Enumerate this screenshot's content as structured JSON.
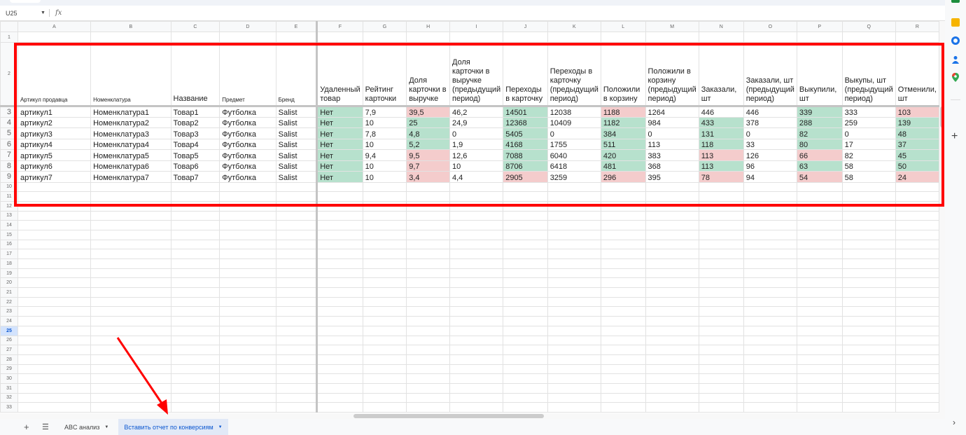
{
  "formula_bar": {
    "cell_ref": "U25",
    "fx": "fx"
  },
  "columns": [
    "A",
    "B",
    "C",
    "D",
    "E",
    "F",
    "G",
    "H",
    "I",
    "J",
    "K",
    "L",
    "M",
    "N",
    "O",
    "P",
    "Q",
    "R"
  ],
  "selected_row": 25,
  "total_rows": 33,
  "headers": [
    "Артикул продавца",
    "Номенклатура",
    "Название",
    "Предмет",
    "Бренд",
    "Удаленный товар",
    "Рейтинг карточки",
    "Доля карточки в выручке",
    "Доля карточки в выручке (предыдущий период)",
    "Переходы в карточку",
    "Переходы в карточку (предыдущий период)",
    "Положили в корзину",
    "Положили в корзину (предыдущий период)",
    "Заказали, шт",
    "Заказали, шт (предыдущий период)",
    "Выкупили, шт",
    "Выкупы, шт (предыдущий период)",
    "Отменили, шт"
  ],
  "rows": [
    [
      "артикул1",
      "Номенклатура1",
      "Товар1",
      "Футболка",
      "Salist",
      "Нет",
      "7,9",
      "39,5",
      "46,2",
      "14501",
      "12038",
      "1188",
      "1264",
      "446",
      "446",
      "339",
      "333",
      "103"
    ],
    [
      "артикул2",
      "Номенклатура2",
      "Товар2",
      "Футболка",
      "Salist",
      "Нет",
      "10",
      "25",
      "24,9",
      "12368",
      "10409",
      "1182",
      "984",
      "433",
      "378",
      "288",
      "259",
      "139"
    ],
    [
      "артикул3",
      "Номенклатура3",
      "Товар3",
      "Футболка",
      "Salist",
      "Нет",
      "7,8",
      "4,8",
      "0",
      "5405",
      "0",
      "384",
      "0",
      "131",
      "0",
      "82",
      "0",
      "48"
    ],
    [
      "артикул4",
      "Номенклатура4",
      "Товар4",
      "Футболка",
      "Salist",
      "Нет",
      "10",
      "5,2",
      "1,9",
      "4168",
      "1755",
      "511",
      "113",
      "118",
      "33",
      "80",
      "17",
      "37"
    ],
    [
      "артикул5",
      "Номенклатура5",
      "Товар5",
      "Футболка",
      "Salist",
      "Нет",
      "9,4",
      "9,5",
      "12,6",
      "7088",
      "6040",
      "420",
      "383",
      "113",
      "126",
      "66",
      "82",
      "45"
    ],
    [
      "артикул6",
      "Номенклатура6",
      "Товар6",
      "Футболка",
      "Salist",
      "Нет",
      "10",
      "9,7",
      "10",
      "8706",
      "6418",
      "481",
      "368",
      "113",
      "96",
      "63",
      "58",
      "50"
    ],
    [
      "артикул7",
      "Номенклатура7",
      "Товар7",
      "Футболка",
      "Salist",
      "Нет",
      "10",
      "3,4",
      "4,4",
      "2905",
      "3259",
      "296",
      "395",
      "78",
      "94",
      "54",
      "58",
      "24"
    ]
  ],
  "cell_colors": [
    [
      "",
      "",
      "",
      "",
      "",
      "g",
      "",
      "r",
      "",
      "g",
      "",
      "r",
      "",
      "",
      "",
      "g",
      "",
      "r"
    ],
    [
      "",
      "",
      "",
      "",
      "",
      "g",
      "",
      "g",
      "",
      "g",
      "",
      "g",
      "",
      "g",
      "",
      "g",
      "",
      "g"
    ],
    [
      "",
      "",
      "",
      "",
      "",
      "g",
      "",
      "g",
      "",
      "g",
      "",
      "g",
      "",
      "g",
      "",
      "g",
      "",
      "g"
    ],
    [
      "",
      "",
      "",
      "",
      "",
      "g",
      "",
      "g",
      "",
      "g",
      "",
      "g",
      "",
      "g",
      "",
      "g",
      "",
      "g"
    ],
    [
      "",
      "",
      "",
      "",
      "",
      "g",
      "",
      "r",
      "",
      "g",
      "",
      "g",
      "",
      "r",
      "",
      "r",
      "",
      "g"
    ],
    [
      "",
      "",
      "",
      "",
      "",
      "g",
      "",
      "r",
      "",
      "g",
      "",
      "g",
      "",
      "g",
      "",
      "g",
      "",
      "g"
    ],
    [
      "",
      "",
      "",
      "",
      "",
      "g",
      "",
      "r",
      "",
      "r",
      "",
      "r",
      "",
      "r",
      "",
      "r",
      "",
      "r"
    ]
  ],
  "colors": {
    "green": "#b7e1cd",
    "red": "#f4cccc",
    "highlight": "#ff0000"
  },
  "sheet_tabs": [
    {
      "label": "ABC анализ",
      "active": false
    },
    {
      "label": "Вставить отчет по конверсиям",
      "active": true
    }
  ]
}
